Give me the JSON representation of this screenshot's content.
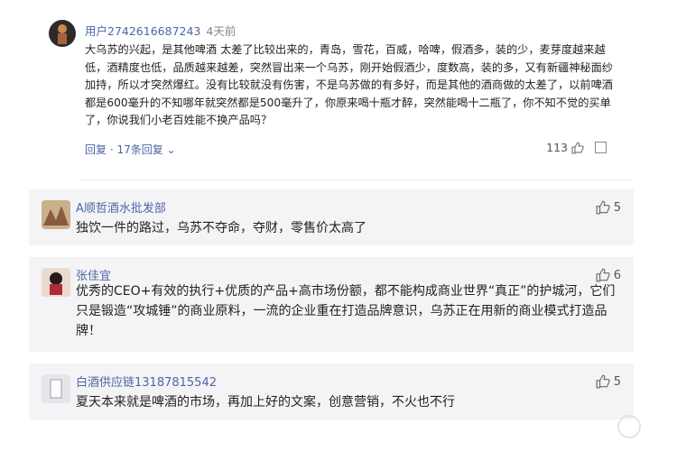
{
  "featured_comment": {
    "username": "用户2742616687243",
    "time": "4天前",
    "text": "大乌苏的兴起，是其他啤酒 太差了比较出来的，青岛，雪花，百威，哈啤，假酒多，装的少，麦芽度越来越低，酒精度也低，品质越来越差，突然冒出来一个乌苏，刚开始假酒少，度数高，装的多，又有新疆神秘面纱加持，所以才突然爆红。没有比较就没有伤害，不是乌苏做的有多好，而是其他的酒商做的太差了，以前啤酒都是600毫升的不知哪年就突然都是500毫升了，你原来喝十瓶才醉，突然能喝十二瓶了，你不知不觉的买单了，你说我们小老百姓能不换产品吗？",
    "reply_label": "回复 · 17条回复",
    "likes": "113",
    "icons": [
      "thumbs-up-icon",
      "report-icon",
      "chevron-down-icon"
    ]
  },
  "replies": [
    {
      "username": "A顺哲酒水批发部",
      "text": "独饮一件的路过，乌苏不夺命，夺财，零售价太高了",
      "likes": "5",
      "avatar_color": "#c9b08a"
    },
    {
      "username": "张佳宜",
      "text": "优秀的CEO+有效的执行+优质的产品+高市场份额，都不能构成商业世界“真正”的护城河，它们只是锻造“攻城锤”的商业原料，一流的企业重在打造品牌意识，乌苏正在用新的商业模式打造品牌！",
      "likes": "6",
      "avatar_color": "#7a3b3b"
    },
    {
      "username": "白酒供应链13187815542",
      "text": "夏天本来就是啤酒的市场，再加上好的文案，创意营销，不火也不行",
      "likes": "5",
      "avatar_color": "#e6e6ea"
    }
  ],
  "colors": {
    "link": "#4b67a5",
    "reply_bg": "#f4f4f6",
    "text": "#222222"
  }
}
